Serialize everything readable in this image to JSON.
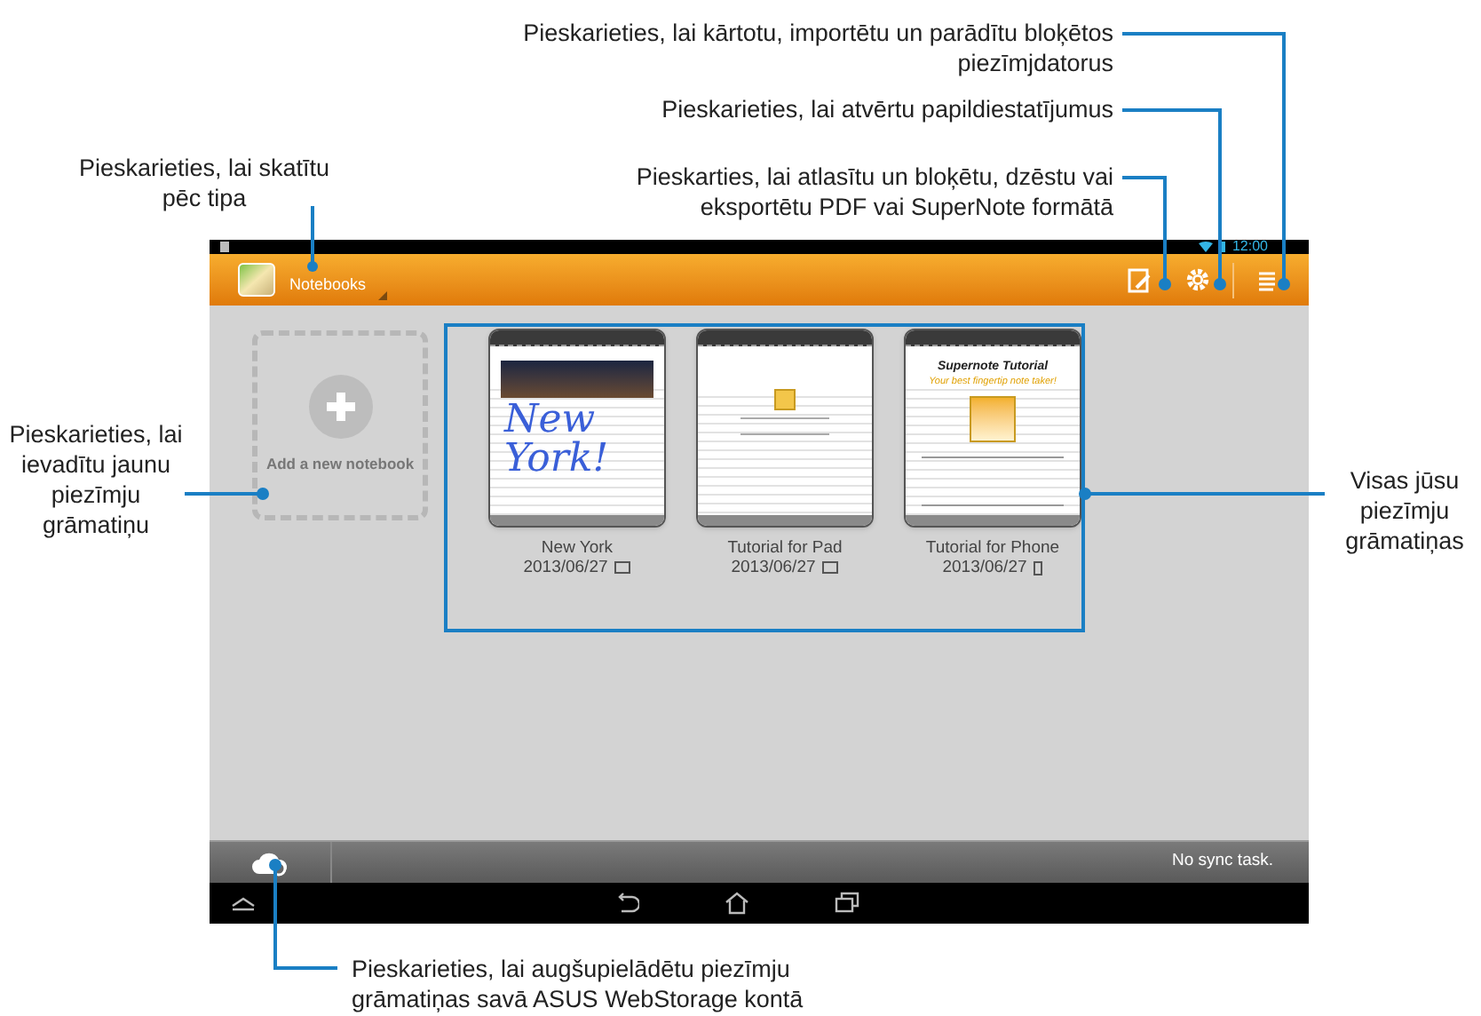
{
  "callouts": [
    {
      "text": "Pieskarieties, lai skatītu pēc tipa"
    },
    {
      "text": "Pieskarieties, lai kārtotu, importētu un parādītu bloķētos piezīmjdatorus"
    },
    {
      "text": "Pieskarieties, lai atvērtu papildiestatījumus"
    },
    {
      "text": "Pieskarties, lai atlasītu un bloķētu, dzēstu vai eksportētu PDF vai SuperNote formātā"
    },
    {
      "text": "Pieskarieties, lai ievadītu jaunu piezīmju grāmatiņu"
    },
    {
      "text": "Visas jūsu piezīmju grāmatiņas"
    },
    {
      "text": "Pieskarieties, lai augšupielādētu piezīmju grāmatiņas savā ASUS WebStorage kontā"
    }
  ],
  "status_bar": {
    "time": "12:00"
  },
  "toolbar": {
    "view_selector": "Notebooks"
  },
  "add_notebook": {
    "label": "Add a new notebook"
  },
  "notebooks": [
    {
      "title": "New York",
      "date": "2013/06/27",
      "phone": false,
      "kind": "photo",
      "handwriting": "New York!"
    },
    {
      "title": "Tutorial for Pad",
      "date": "2013/06/27",
      "phone": false,
      "kind": "mini"
    },
    {
      "title": "Tutorial for Phone",
      "date": "2013/06/27",
      "phone": true,
      "kind": "tutorial",
      "heading": "Supernote Tutorial",
      "subheading": "Your best fingertip note taker!"
    }
  ],
  "sync_bar": {
    "status": "No sync task."
  }
}
